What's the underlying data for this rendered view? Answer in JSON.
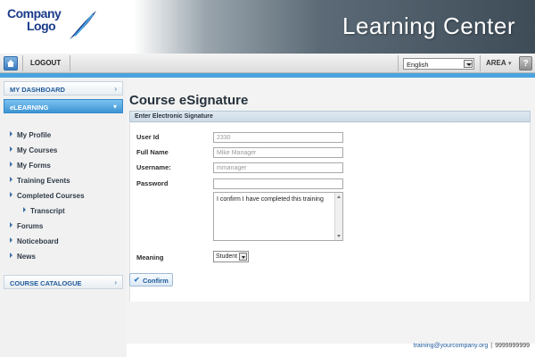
{
  "header": {
    "logo_line1": "Company",
    "logo_line2": "Logo",
    "app_title": "Learning Center"
  },
  "toolbar": {
    "logout_label": "LOGOUT",
    "language_value": "English",
    "area_label": "AREA",
    "help_label": "?"
  },
  "sidebar": {
    "dashboard_label": "MY DASHBOARD",
    "elearning_label": "eLEARNING",
    "items": [
      {
        "label": "My Profile"
      },
      {
        "label": "My Courses"
      },
      {
        "label": "My Forms"
      },
      {
        "label": "Training Events"
      },
      {
        "label": "Completed Courses"
      },
      {
        "label": "Transcript"
      },
      {
        "label": "Forums"
      },
      {
        "label": "Noticeboard"
      },
      {
        "label": "News"
      }
    ],
    "catalogue_label": "COURSE CATALOGUE"
  },
  "main": {
    "page_title": "Course eSignature",
    "section_title": "Enter Electronic Signature",
    "fields": {
      "user_id_label": "User Id",
      "user_id_value": "2330",
      "full_name_label": "Full Name",
      "full_name_value": "Mike Manager",
      "username_label": "Username:",
      "username_value": "mmanager",
      "password_label": "Password",
      "password_value": "",
      "statement_value": "I confirm I have completed this training",
      "meaning_label": "Meaning",
      "meaning_value": "Student"
    },
    "confirm_label": "Confirm"
  },
  "footer": {
    "email": "training@yourcompany.org",
    "separator": "|",
    "phone": "9999999999"
  },
  "colors": {
    "accent_blue": "#4aa3de",
    "header_dark": "#3e4c58",
    "link_blue": "#1f5a9a"
  }
}
